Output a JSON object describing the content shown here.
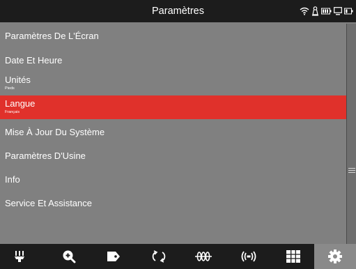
{
  "header": {
    "title": "Paramètres"
  },
  "status_icons": [
    "wifi-icon",
    "probe-icon",
    "battery-icon",
    "monitor-icon",
    "battery-small-icon"
  ],
  "menu": {
    "items": [
      {
        "label": "Paramètres De L'Écran"
      },
      {
        "label": "Date Et Heure"
      },
      {
        "label": "Unités",
        "value": "Pieds"
      },
      {
        "label": "Langue",
        "value": "Français",
        "selected": true
      },
      {
        "label": "Mise À Jour Du Système"
      },
      {
        "label": "Paramètres D'Usine"
      },
      {
        "label": "Info"
      },
      {
        "label": "Service Et Assistance"
      }
    ]
  },
  "toolbar": {
    "buttons": [
      "camera-head-icon",
      "zoom-in-icon",
      "tag-icon",
      "rotate-icon",
      "sonde-icon",
      "locator-icon",
      "grid-icon",
      "gear-icon"
    ],
    "active": "gear-icon"
  },
  "colors": {
    "background": "#808080",
    "bar": "#1c1c1c",
    "selected": "#e0312b",
    "text": "#ffffff"
  }
}
